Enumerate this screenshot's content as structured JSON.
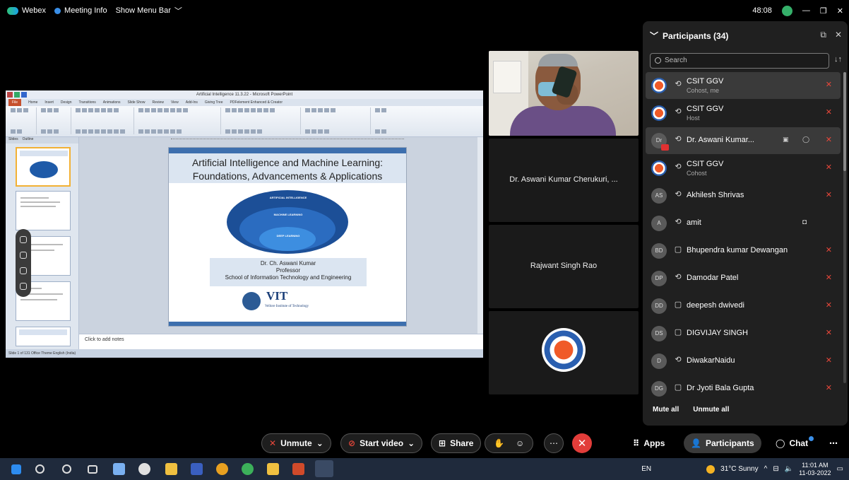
{
  "titlebar": {
    "app": "Webex",
    "meeting_info": "Meeting Info",
    "menu": "Show Menu Bar",
    "timer": "48:08"
  },
  "share": {
    "ppt_window_title": "Artificial Intelligence  11.3.22 - Microsoft PowerPoint",
    "ribbon_tabs": [
      "File",
      "Home",
      "Insert",
      "Design",
      "Transitions",
      "Animations",
      "Slide Show",
      "Review",
      "View",
      "Add-Ins",
      "Giving Tree",
      "PDFelement Enhanced & Creator"
    ],
    "slide_title_line1": "Artificial Intelligence and Machine Learning:",
    "slide_title_line2": "Foundations, Advancements & Applications",
    "ellipse_labels": [
      "ARTIFICIAL INTELLIGENCE",
      "MACHINE LEARNING",
      "DEEP LEARNING"
    ],
    "author_name": "Dr. Ch. Aswani Kumar",
    "author_role": "Professor",
    "author_school": "School of Information Technology and Engineering",
    "logo_text": "VIT",
    "logo_sub": "Vellore Institute of Technology",
    "notes_placeholder": "Click to add notes",
    "thumb_tabs": [
      "Slides",
      "Outline"
    ],
    "status_text": "Slide 1 of 131    Office Theme    English (India)"
  },
  "tiles": [
    {
      "name": "Dr. Aswani Kumar Cherukuri, ..."
    },
    {
      "name": "Rajwant Singh Rao"
    }
  ],
  "participants": {
    "title": "Participants (34)",
    "search_placeholder": "Search",
    "list": [
      {
        "avatar": "",
        "name": "CSIT GGV",
        "role": "Cohost, me",
        "state": "⟲",
        "mute": "✕",
        "brand": true
      },
      {
        "avatar": "",
        "name": "CSIT GGV",
        "role": "Host",
        "state": "⟲",
        "mute": "✕",
        "brand": true
      },
      {
        "avatar": "Dr",
        "name": "Dr. Aswani Kumar...",
        "role": "",
        "state": "⟲",
        "mute": "✕",
        "brand": false
      },
      {
        "avatar": "",
        "name": "CSIT GGV",
        "role": "Cohost",
        "state": "⟲",
        "mute": "✕",
        "brand": true
      },
      {
        "avatar": "AS",
        "name": "Akhilesh Shrivas",
        "role": "",
        "state": "⟲",
        "mute": "✕",
        "brand": false
      },
      {
        "avatar": "A",
        "name": "amit",
        "role": "",
        "state": "⟲",
        "mute": "",
        "brand": false
      },
      {
        "avatar": "BD",
        "name": "Bhupendra kumar Dewangan",
        "role": "",
        "state": "▢",
        "mute": "✕",
        "brand": false
      },
      {
        "avatar": "DP",
        "name": "Damodar Patel",
        "role": "",
        "state": "⟲",
        "mute": "✕",
        "brand": false
      },
      {
        "avatar": "DD",
        "name": "deepesh dwivedi",
        "role": "",
        "state": "▢",
        "mute": "✕",
        "brand": false
      },
      {
        "avatar": "DS",
        "name": "DIGVIJAY SINGH",
        "role": "",
        "state": "▢",
        "mute": "✕",
        "brand": false
      },
      {
        "avatar": "D",
        "name": "DiwakarNaidu",
        "role": "",
        "state": "⟲",
        "mute": "✕",
        "brand": false
      },
      {
        "avatar": "DG",
        "name": "Dr Jyoti Bala Gupta",
        "role": "",
        "state": "▢",
        "mute": "✕",
        "brand": false
      }
    ],
    "mute_all": "Mute all",
    "unmute_all": "Unmute all"
  },
  "controls": {
    "unmute": "Unmute",
    "start_video": "Start video",
    "share": "Share",
    "apps": "Apps",
    "participants": "Participants",
    "chat": "Chat"
  },
  "taskbar": {
    "lang": "EN",
    "weather": "31°C  Sunny",
    "time": "11:01 AM",
    "date": "11-03-2022"
  },
  "colors": {
    "accent_red": "#e23d3a",
    "panel_bg": "#202020",
    "taskbar_bg": "#1f2a3c"
  }
}
